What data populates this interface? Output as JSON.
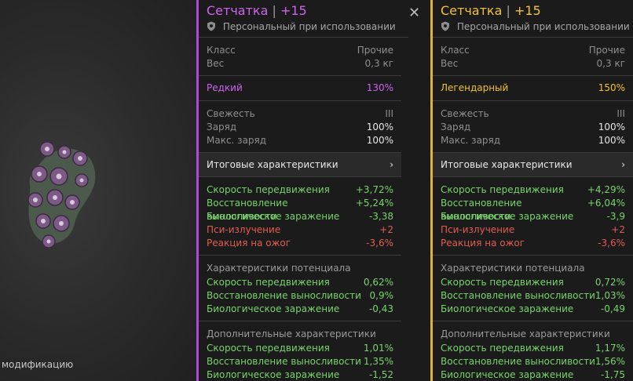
{
  "scene": {
    "hint": "модификацию"
  },
  "left": {
    "title": "Сетчатка",
    "sep": "|",
    "level": "+15",
    "subtitle": "Персональный при использовании",
    "class_label": "Класс",
    "class_value": "Прочие",
    "weight_label": "Вес",
    "weight_value": "0,3 кг",
    "rarity_label": "Редкий",
    "rarity_value": "130%",
    "rarity_color": "#cf63f0",
    "freshness_label": "Свежесть",
    "freshness_value": "III",
    "charge_label": "Заряд",
    "charge_value": "100%",
    "max_charge_label": "Макс. заряд",
    "max_charge_value": "100%",
    "summary_label": "Итоговые характеристики",
    "summary_chevron": "›",
    "stats": [
      {
        "label": "Скорость передвижения",
        "value": "+3,72%",
        "color": "green"
      },
      {
        "label": "Восстановление выносливости",
        "value": "+5,24%",
        "color": "green"
      },
      {
        "label": "Биологическое заражение",
        "value": "-3,38",
        "color": "green"
      },
      {
        "label": "Пси-излучение",
        "value": "+2",
        "color": "red"
      },
      {
        "label": "Реакция на ожог",
        "value": "-3,6%",
        "color": "red"
      }
    ],
    "potential_title": "Характеристики потенциала",
    "potential": [
      {
        "label": "Скорость передвижения",
        "value": "0,62%"
      },
      {
        "label": "Восстановление выносливости",
        "value": "0,9%"
      },
      {
        "label": "Биологическое заражение",
        "value": "-0,43"
      }
    ],
    "extra_title": "Дополнительные характеристики",
    "extra": [
      {
        "label": "Скорость передвижения",
        "value": "1,01%"
      },
      {
        "label": "Восстановление выносливости",
        "value": "1,35%"
      },
      {
        "label": "Биологическое заражение",
        "value": "-1,52"
      }
    ]
  },
  "right": {
    "title": "Сетчатка",
    "sep": "|",
    "level": "+15",
    "subtitle": "Персональный при использовании",
    "class_label": "Класс",
    "class_value": "Прочие",
    "weight_label": "Вес",
    "weight_value": "0,3 кг",
    "rarity_label": "Легендарный",
    "rarity_value": "150%",
    "rarity_color": "#f1c232",
    "freshness_label": "Свежесть",
    "freshness_value": "III",
    "charge_label": "Заряд",
    "charge_value": "100%",
    "max_charge_label": "Макс. заряд",
    "max_charge_value": "100%",
    "summary_label": "Итоговые характеристики",
    "summary_chevron": "›",
    "stats": [
      {
        "label": "Скорость передвижения",
        "value": "+4,29%",
        "color": "green"
      },
      {
        "label": "Восстановление выносливости",
        "value": "+6,04%",
        "color": "green"
      },
      {
        "label": "Биологическое заражение",
        "value": "-3,9",
        "color": "green"
      },
      {
        "label": "Пси-излучение",
        "value": "+2",
        "color": "red"
      },
      {
        "label": "Реакция на ожог",
        "value": "-3,6%",
        "color": "red"
      }
    ],
    "potential_title": "Характеристики потенциала",
    "potential": [
      {
        "label": "Скорость передвижения",
        "value": "0,72%"
      },
      {
        "label": "Восстановление выносливости",
        "value": "1,03%"
      },
      {
        "label": "Биологическое заражение",
        "value": "-0,49"
      }
    ],
    "extra_title": "Дополнительные характеристики",
    "extra": [
      {
        "label": "Скорость передвижения",
        "value": "1,17%"
      },
      {
        "label": "Восстановление выносливости",
        "value": "1,56%"
      },
      {
        "label": "Биологическое заражение",
        "value": "-1,75"
      }
    ]
  },
  "icons": {
    "shield": "shield-icon",
    "close": "close-icon",
    "chevron": "chevron-right-icon"
  },
  "colors": {
    "green": "#79d36c",
    "red": "#e05c52",
    "epic": "#cf63f0",
    "legendary": "#f1c232"
  }
}
